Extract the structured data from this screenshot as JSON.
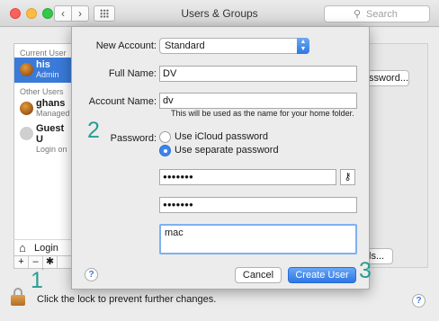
{
  "window": {
    "title": "Users & Groups"
  },
  "toolbar": {
    "back": "‹",
    "forward": "›"
  },
  "search": {
    "placeholder": "Search",
    "icon": "search-icon"
  },
  "sidebar": {
    "current_user_header": "Current User",
    "current_user": {
      "name": "his",
      "role": "Admin"
    },
    "other_users_header": "Other Users",
    "other_users": [
      {
        "name": "ghans",
        "role": "Managed"
      },
      {
        "name": "Guest U",
        "role": "Login on"
      }
    ],
    "login_options": "Login Op",
    "add_label": "+",
    "remove_label": "–",
    "gear_label": "✱"
  },
  "background": {
    "password_button": "ssword...",
    "options_button": "ls..."
  },
  "footer": {
    "lock_text": "Click the lock to prevent further changes.",
    "help": "?"
  },
  "sheet": {
    "new_account_label": "New Account:",
    "new_account_value": "Standard",
    "full_name_label": "Full Name:",
    "full_name_value": "DV",
    "account_name_label": "Account Name:",
    "account_name_value": "dv",
    "account_name_hint": "This will be used as the name for your home folder.",
    "password_label": "Password:",
    "radio_icloud": "Use iCloud password",
    "radio_separate": "Use separate password",
    "selected_radio": "Use separate password",
    "password_value": "●●●●●●●",
    "verify_value": "●●●●●●●",
    "hint_value": "mac",
    "cancel_button": "Cancel",
    "create_button": "Create User",
    "help": "?"
  },
  "annotations": [
    "1",
    "2",
    "3"
  ],
  "colors": {
    "accent": "#3d85ec",
    "annotation": "#2a9d8f",
    "selection": "#3a7ad9"
  }
}
